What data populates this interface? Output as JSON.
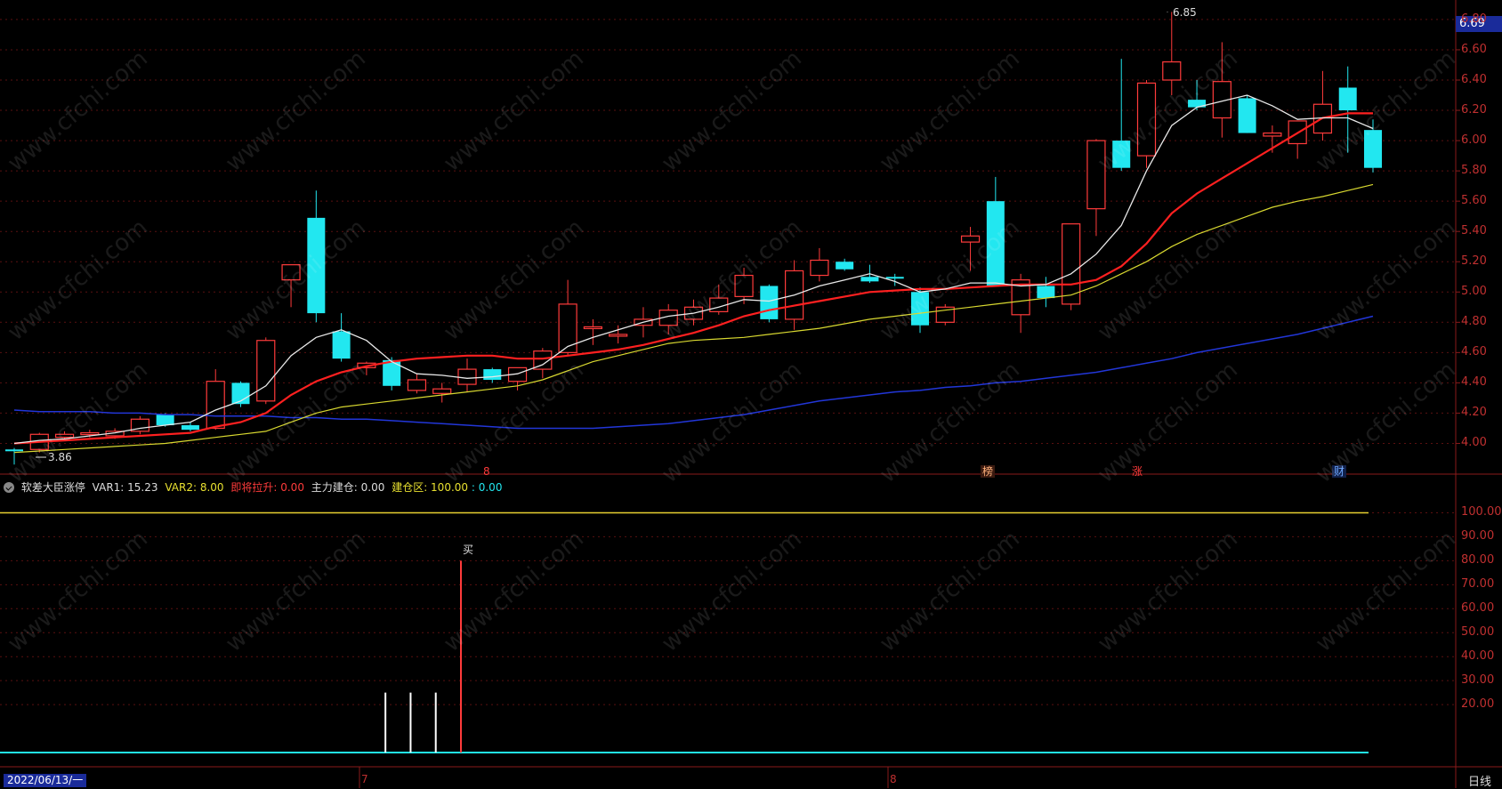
{
  "title_fragment": "",
  "current_price": "6.69",
  "price_axis": [
    "6.80",
    "6.60",
    "6.40",
    "6.20",
    "6.00",
    "5.80",
    "5.60",
    "5.40",
    "5.20",
    "5.00",
    "4.80",
    "4.60",
    "4.40",
    "4.20",
    "4.00"
  ],
  "indicator_axis": [
    "100.00",
    "90.00",
    "80.00",
    "70.00",
    "60.00",
    "50.00",
    "40.00",
    "30.00",
    "20.00"
  ],
  "indicator": {
    "name": "软差大臣涨停",
    "var1": "VAR1: 15.23",
    "var2": "VAR2: 8.00",
    "lift": "即将拉升: 0.00",
    "build": "主力建仓: 0.00",
    "zone_label": "建仓区: 100.00",
    "zone_value": ": 0.00"
  },
  "high_label": "6.85",
  "low_label": "3.86",
  "buy_label": "买",
  "date_label": "2022/06/13/一",
  "months": [
    "7",
    "8"
  ],
  "period": "日线",
  "events": [
    {
      "text": "8",
      "color": "#ff3b3b"
    },
    {
      "text": "榜",
      "color": "#ffb07a"
    },
    {
      "text": "涨",
      "color": "#ff3b3b"
    },
    {
      "text": "财",
      "color": "#6fa8ff"
    }
  ],
  "watermark": "www.cfchi.com",
  "colors": {
    "up": "#ff3b3b",
    "down": "#22e7f0",
    "ma5": "#e8e8e8",
    "ma10": "#ff2020",
    "ma20": "#d8d830",
    "ma60": "#2236d8",
    "grid": "#5a1010",
    "axis": "#8a1a1a"
  },
  "chart_data": {
    "type": "candlestick",
    "price_ylim": [
      3.8,
      6.85
    ],
    "candles": [
      {
        "o": 3.96,
        "h": 3.97,
        "l": 3.86,
        "c": 3.95
      },
      {
        "o": 3.96,
        "h": 4.07,
        "l": 3.94,
        "c": 4.06
      },
      {
        "o": 4.04,
        "h": 4.08,
        "l": 4.02,
        "c": 4.06
      },
      {
        "o": 4.06,
        "h": 4.09,
        "l": 4.04,
        "c": 4.07
      },
      {
        "o": 4.05,
        "h": 4.1,
        "l": 4.03,
        "c": 4.08
      },
      {
        "o": 4.08,
        "h": 4.18,
        "l": 4.06,
        "c": 4.16
      },
      {
        "o": 4.19,
        "h": 4.2,
        "l": 4.11,
        "c": 4.12
      },
      {
        "o": 4.12,
        "h": 4.14,
        "l": 4.08,
        "c": 4.09
      },
      {
        "o": 4.1,
        "h": 4.49,
        "l": 4.09,
        "c": 4.41
      },
      {
        "o": 4.4,
        "h": 4.41,
        "l": 4.24,
        "c": 4.26
      },
      {
        "o": 4.28,
        "h": 4.7,
        "l": 4.26,
        "c": 4.68
      },
      {
        "o": 5.08,
        "h": 5.18,
        "l": 4.9,
        "c": 5.18
      },
      {
        "o": 5.49,
        "h": 5.67,
        "l": 4.8,
        "c": 4.86
      },
      {
        "o": 4.74,
        "h": 4.86,
        "l": 4.54,
        "c": 4.56
      },
      {
        "o": 4.5,
        "h": 4.54,
        "l": 4.45,
        "c": 4.53
      },
      {
        "o": 4.55,
        "h": 4.57,
        "l": 4.35,
        "c": 4.38
      },
      {
        "o": 4.35,
        "h": 4.46,
        "l": 4.33,
        "c": 4.42
      },
      {
        "o": 4.33,
        "h": 4.4,
        "l": 4.27,
        "c": 4.36
      },
      {
        "o": 4.39,
        "h": 4.56,
        "l": 4.34,
        "c": 4.49
      },
      {
        "o": 4.49,
        "h": 4.5,
        "l": 4.4,
        "c": 4.42
      },
      {
        "o": 4.41,
        "h": 4.49,
        "l": 4.35,
        "c": 4.5
      },
      {
        "o": 4.49,
        "h": 4.63,
        "l": 4.43,
        "c": 4.61
      },
      {
        "o": 4.6,
        "h": 5.08,
        "l": 4.58,
        "c": 4.92
      },
      {
        "o": 4.77,
        "h": 4.82,
        "l": 4.65,
        "c": 4.77
      },
      {
        "o": 4.72,
        "h": 4.78,
        "l": 4.66,
        "c": 4.72
      },
      {
        "o": 4.78,
        "h": 4.9,
        "l": 4.7,
        "c": 4.82
      },
      {
        "o": 4.78,
        "h": 4.92,
        "l": 4.72,
        "c": 4.88
      },
      {
        "o": 4.82,
        "h": 4.95,
        "l": 4.78,
        "c": 4.9
      },
      {
        "o": 4.87,
        "h": 5.05,
        "l": 4.85,
        "c": 4.96
      },
      {
        "o": 4.97,
        "h": 5.16,
        "l": 4.92,
        "c": 5.11
      },
      {
        "o": 5.04,
        "h": 5.05,
        "l": 4.8,
        "c": 4.82
      },
      {
        "o": 4.82,
        "h": 5.21,
        "l": 4.75,
        "c": 5.14
      },
      {
        "o": 5.11,
        "h": 5.29,
        "l": 5.07,
        "c": 5.21
      },
      {
        "o": 5.2,
        "h": 5.22,
        "l": 5.14,
        "c": 5.15
      },
      {
        "o": 5.1,
        "h": 5.18,
        "l": 5.06,
        "c": 5.07
      },
      {
        "o": 5.1,
        "h": 5.12,
        "l": 5.04,
        "c": 5.09
      },
      {
        "o": 5.0,
        "h": 5.03,
        "l": 4.73,
        "c": 4.78
      },
      {
        "o": 4.8,
        "h": 4.92,
        "l": 4.78,
        "c": 4.9
      },
      {
        "o": 5.33,
        "h": 5.43,
        "l": 5.14,
        "c": 5.37
      },
      {
        "o": 5.6,
        "h": 5.76,
        "l": 5.04,
        "c": 5.04
      },
      {
        "o": 4.85,
        "h": 5.12,
        "l": 4.73,
        "c": 5.08
      },
      {
        "o": 5.04,
        "h": 5.1,
        "l": 4.9,
        "c": 4.96
      },
      {
        "o": 4.92,
        "h": 5.14,
        "l": 4.88,
        "c": 5.45
      },
      {
        "o": 5.55,
        "h": 6.01,
        "l": 5.37,
        "c": 6.0
      },
      {
        "o": 6.0,
        "h": 6.54,
        "l": 5.8,
        "c": 5.82
      },
      {
        "o": 5.9,
        "h": 6.4,
        "l": 5.82,
        "c": 6.38
      },
      {
        "o": 6.4,
        "h": 6.85,
        "l": 6.3,
        "c": 6.52
      },
      {
        "o": 6.27,
        "h": 6.4,
        "l": 6.2,
        "c": 6.22
      },
      {
        "o": 6.15,
        "h": 6.65,
        "l": 6.02,
        "c": 6.39
      },
      {
        "o": 6.28,
        "h": 6.3,
        "l": 6.05,
        "c": 6.05
      },
      {
        "o": 6.03,
        "h": 6.1,
        "l": 5.92,
        "c": 6.05
      },
      {
        "o": 5.98,
        "h": 6.1,
        "l": 5.88,
        "c": 6.13
      },
      {
        "o": 6.05,
        "h": 6.46,
        "l": 6.0,
        "c": 6.24
      },
      {
        "o": 6.35,
        "h": 6.49,
        "l": 5.92,
        "c": 6.2
      },
      {
        "o": 6.07,
        "h": 6.14,
        "l": 5.79,
        "c": 5.82
      }
    ],
    "ma5": [
      4.0,
      4.02,
      4.03,
      4.05,
      4.07,
      4.1,
      4.12,
      4.14,
      4.22,
      4.28,
      4.38,
      4.58,
      4.7,
      4.75,
      4.68,
      4.54,
      4.46,
      4.45,
      4.43,
      4.44,
      4.46,
      4.52,
      4.64,
      4.7,
      4.75,
      4.8,
      4.84,
      4.86,
      4.9,
      4.95,
      4.94,
      4.98,
      5.04,
      5.08,
      5.12,
      5.07,
      5.0,
      5.02,
      5.06,
      5.06,
      5.04,
      5.05,
      5.12,
      5.25,
      5.44,
      5.8,
      6.1,
      6.22,
      6.26,
      6.3,
      6.23,
      6.14,
      6.15,
      6.15,
      6.08
    ],
    "ma10": [
      4.0,
      4.01,
      4.02,
      4.03,
      4.04,
      4.05,
      4.06,
      4.07,
      4.11,
      4.14,
      4.2,
      4.32,
      4.41,
      4.47,
      4.51,
      4.54,
      4.56,
      4.57,
      4.58,
      4.58,
      4.56,
      4.56,
      4.58,
      4.6,
      4.62,
      4.65,
      4.69,
      4.73,
      4.78,
      4.84,
      4.88,
      4.91,
      4.94,
      4.97,
      5.0,
      5.01,
      5.02,
      5.02,
      5.03,
      5.04,
      5.05,
      5.05,
      5.05,
      5.08,
      5.17,
      5.32,
      5.52,
      5.65,
      5.75,
      5.85,
      5.95,
      6.05,
      6.15,
      6.18,
      6.18
    ],
    "ma20": [
      3.94,
      3.95,
      3.96,
      3.97,
      3.98,
      3.99,
      4.0,
      4.02,
      4.04,
      4.06,
      4.08,
      4.14,
      4.2,
      4.24,
      4.26,
      4.28,
      4.3,
      4.32,
      4.34,
      4.36,
      4.38,
      4.42,
      4.48,
      4.54,
      4.58,
      4.62,
      4.66,
      4.68,
      4.69,
      4.7,
      4.72,
      4.74,
      4.76,
      4.79,
      4.82,
      4.84,
      4.86,
      4.88,
      4.9,
      4.92,
      4.94,
      4.96,
      4.98,
      5.04,
      5.12,
      5.2,
      5.3,
      5.38,
      5.44,
      5.5,
      5.56,
      5.6,
      5.63,
      5.67,
      5.71
    ],
    "ma60": [
      4.22,
      4.21,
      4.21,
      4.21,
      4.2,
      4.2,
      4.19,
      4.19,
      4.18,
      4.18,
      4.18,
      4.17,
      4.17,
      4.16,
      4.16,
      4.15,
      4.14,
      4.13,
      4.12,
      4.11,
      4.1,
      4.1,
      4.1,
      4.1,
      4.11,
      4.12,
      4.13,
      4.15,
      4.17,
      4.19,
      4.22,
      4.25,
      4.28,
      4.3,
      4.32,
      4.34,
      4.35,
      4.37,
      4.38,
      4.4,
      4.41,
      4.43,
      4.45,
      4.47,
      4.5,
      4.53,
      4.56,
      4.6,
      4.63,
      4.66,
      4.69,
      4.72,
      4.76,
      4.8,
      4.84
    ],
    "indicator_ylim": [
      0,
      105
    ],
    "zone_line": 100,
    "bars": [
      {
        "index": 15,
        "value": 25,
        "color": "white"
      },
      {
        "index": 16,
        "value": 25,
        "color": "white"
      },
      {
        "index": 17,
        "value": 25,
        "color": "white"
      },
      {
        "index": 18,
        "value": 80,
        "color": "red"
      }
    ]
  }
}
